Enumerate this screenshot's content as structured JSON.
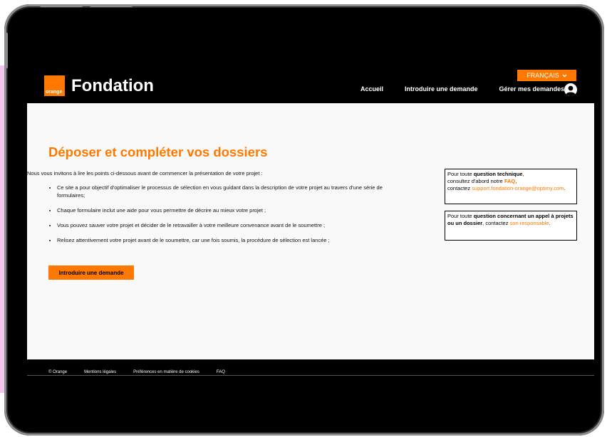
{
  "header": {
    "logo_small": "orange",
    "logo_text": "Fondation",
    "language": "FRANÇAIS",
    "nav": [
      "Accueil",
      "Introduire une demande",
      "Gérer mes demandes"
    ]
  },
  "main": {
    "title": "Déposer et compléter vos dossiers",
    "intro": "Nous vous invitons à lire les points ci-dessous avant de commencer la présentation de votre projet :",
    "bullets": [
      "Ce site a pour objectif d'optimaliser le processus de sélection en vous guidant dans la description de votre projet au travers d'une série de formulaires;",
      "Chaque formulaire inclut une aide pour vous permettre de décrire au mieux votre projet ;",
      "Vous pouvez sauver votre projet et décider de le retravailler à votre meilleure convenance avant de le soumettre ;",
      "Relisez attentivement votre projet avant de le soumettre, car une fois soumis, la procédure de sélection est lancée ;"
    ],
    "cta": "Introduire une demande"
  },
  "help_boxes": {
    "box1": {
      "t1": "Pour toute ",
      "b1": "question technique",
      "t2": ",",
      "t3": "consultez d'abord notre ",
      "link_faq": "FAQ",
      "t4": ",",
      "t5": "contactez ",
      "link_support": "support.fondation-orange@optimy.com",
      "t6": "."
    },
    "box2": {
      "t1": "Pour toute ",
      "b1": "question concernant un appel à projets ou un dossier",
      "t2": ", contactez ",
      "link_resp": "son responsable",
      "t3": "."
    }
  },
  "footer": {
    "links": [
      "© Orange",
      "Mentions légales",
      "Préférences en matière de cookies",
      "FAQ"
    ]
  },
  "colors": {
    "brand": "#ff7900",
    "dark": "#000000",
    "content_bg": "#f9f9f9"
  },
  "icons": {
    "user": "user-circle-icon",
    "chevron": "chevron-down-icon"
  }
}
